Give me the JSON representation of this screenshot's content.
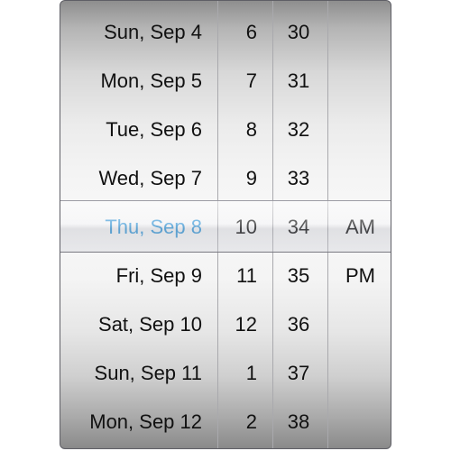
{
  "picker": {
    "dates": [
      "Sun, Sep 4",
      "Mon, Sep 5",
      "Tue, Sep 6",
      "Wed, Sep 7",
      "Thu, Sep 8",
      "Fri, Sep 9",
      "Sat, Sep 10",
      "Sun, Sep 11",
      "Mon, Sep 12"
    ],
    "hours": [
      "6",
      "7",
      "8",
      "9",
      "10",
      "11",
      "12",
      "1",
      "2"
    ],
    "minutes": [
      "30",
      "31",
      "32",
      "33",
      "34",
      "35",
      "36",
      "37",
      "38"
    ],
    "periods": [
      "AM",
      "PM"
    ],
    "selected": {
      "date": "Thu, Sep 8",
      "hour": "10",
      "minute": "34",
      "period": "AM"
    },
    "colors": {
      "selected_text": "#3a9ad9",
      "text": "#111111"
    }
  }
}
